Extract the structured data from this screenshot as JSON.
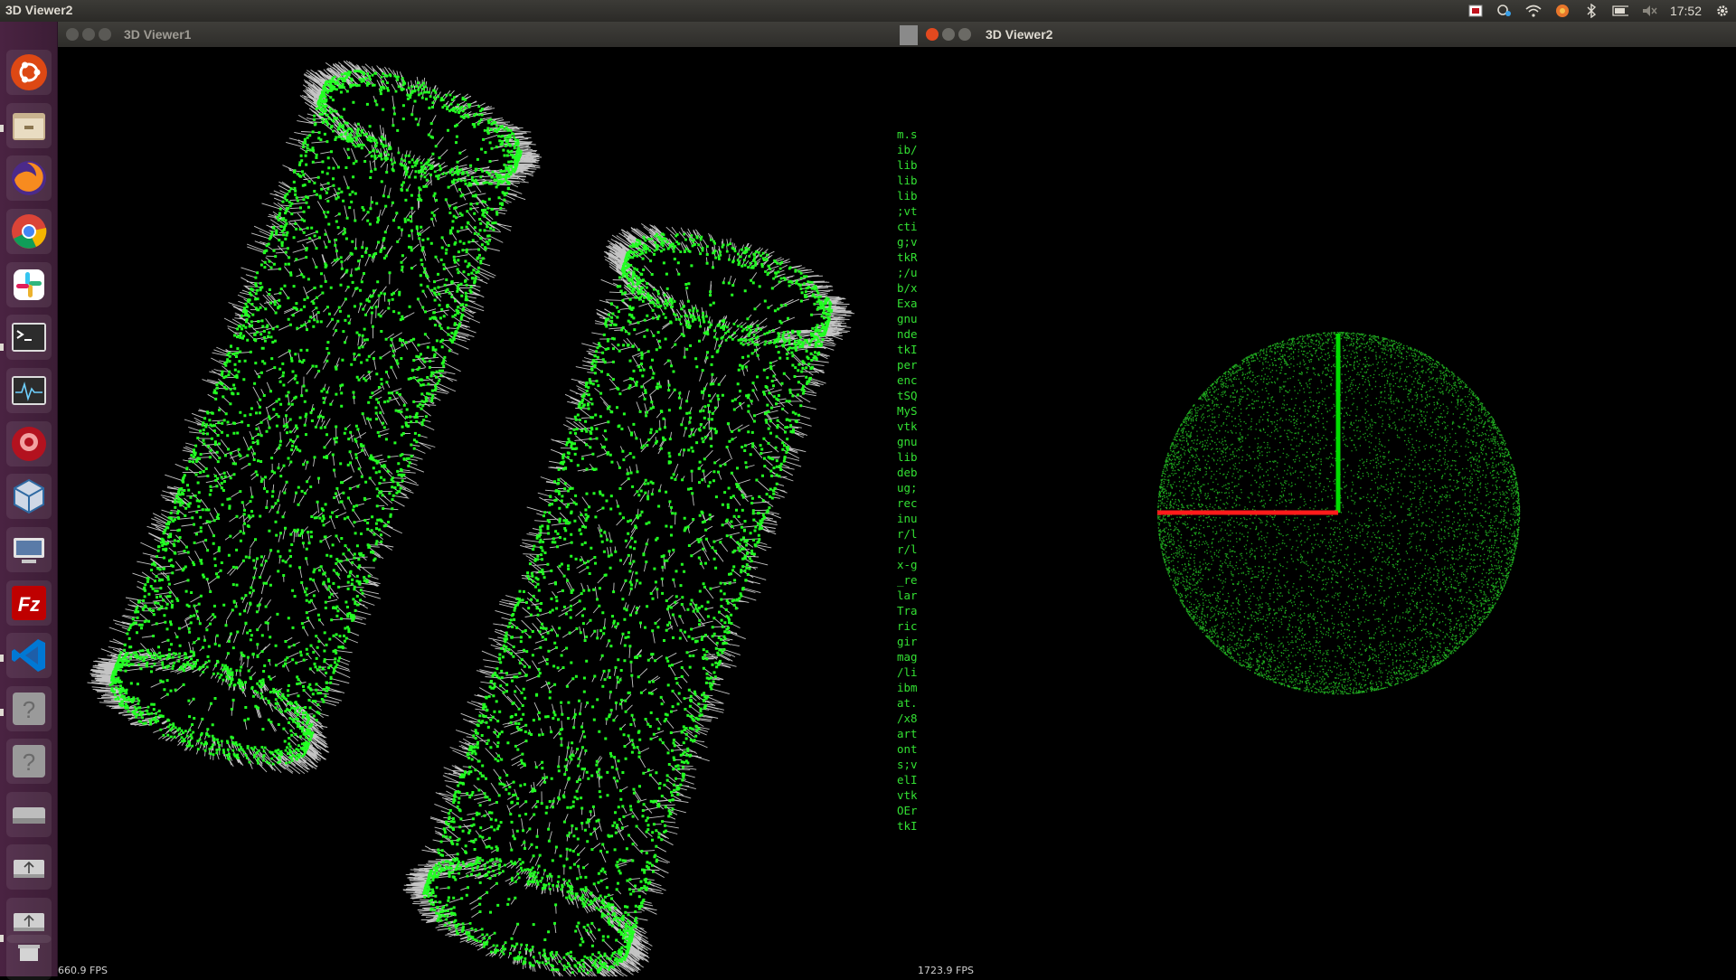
{
  "topbar": {
    "app_title": "3D Viewer2",
    "clock": "17:52",
    "indicators": [
      "record-icon",
      "dropbox-icon",
      "wifi-icon",
      "weather-icon",
      "bluetooth-icon",
      "battery-icon",
      "volume-muted-icon",
      "settings-gear-icon"
    ]
  },
  "launcher": {
    "items": [
      {
        "name": "ubuntu-dash-icon",
        "color": "#dd4814"
      },
      {
        "name": "files-icon",
        "color": "#c9b38f"
      },
      {
        "name": "firefox-icon",
        "color": "#f78b1f"
      },
      {
        "name": "chrome-icon",
        "color": "#4285f4"
      },
      {
        "name": "slack-icon",
        "color": "#36c5f0"
      },
      {
        "name": "terminal-icon",
        "color": "#2c2c2c"
      },
      {
        "name": "system-monitor-icon",
        "color": "#2c2c2c"
      },
      {
        "name": "screen-recorder-icon",
        "color": "#b3121f"
      },
      {
        "name": "virtualbox-icon",
        "color": "#2f6aa3"
      },
      {
        "name": "remote-desktop-icon",
        "color": "#5a7ba8"
      },
      {
        "name": "filezilla-icon",
        "color": "#bf0000"
      },
      {
        "name": "vscode-icon",
        "color": "#0078d4"
      },
      {
        "name": "unknown-app-icon",
        "color": "#9a9a9a"
      },
      {
        "name": "unknown-app-icon",
        "color": "#9a9a9a"
      },
      {
        "name": "drive-icon",
        "color": "#bdbdbd"
      },
      {
        "name": "usb-drive-icon",
        "color": "#d0d0d0"
      },
      {
        "name": "usb-drive-icon",
        "color": "#d0d0d0"
      },
      {
        "name": "trash-icon",
        "color": "#bdbdbd"
      }
    ]
  },
  "window1": {
    "title": "3D Viewer1",
    "fps": "660.9 FPS"
  },
  "window2": {
    "title": "3D Viewer2",
    "fps": "1723.9 FPS"
  },
  "terminal_strip": {
    "lines": [
      "m.s",
      "ib/",
      "lib",
      "lib",
      "lib",
      ";vt",
      "cti",
      "g;v",
      "tkR",
      ";/u",
      "b/x",
      "Exa",
      "gnu",
      "nde",
      "tkI",
      "per",
      "enc",
      "tSQ",
      "MyS",
      "vtk",
      "gnu",
      "lib",
      "deb",
      "ug;",
      "rec",
      "inu",
      "r/l",
      "r/l",
      "x-g",
      "_re",
      "lar",
      "Tra",
      "ric",
      "gir",
      "mag",
      "/li",
      "ibm",
      "at.",
      "/x8",
      "art",
      "ont",
      "s;v",
      "elI",
      "vtk",
      "OEr",
      "tkI"
    ]
  },
  "colors": {
    "point_green": "#22ff22",
    "normal_white": "#e6e6e6",
    "axis_red": "#ff1a1a",
    "axis_green": "#00dd00",
    "launcher_bg": "#4a2342"
  }
}
